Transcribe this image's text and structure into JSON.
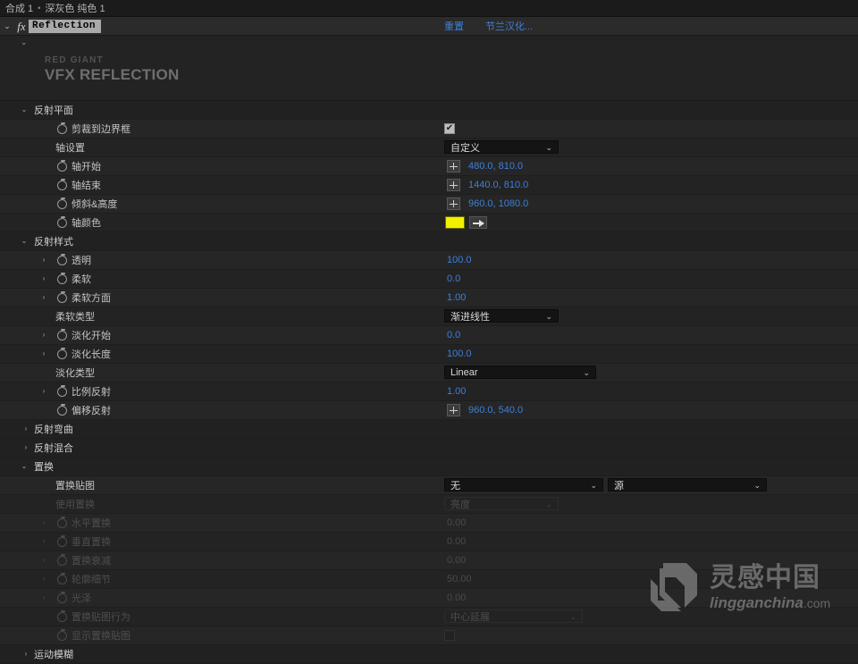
{
  "comp_bar": {
    "comp_name": "合成 1",
    "separator": "•",
    "layer_name": "深灰色 纯色 1"
  },
  "effect_header": {
    "twirl": "⌄",
    "fx_icon": "fx",
    "effect_name": "Reflection",
    "reset_label": "重置",
    "translate_label": "节兰汉化..."
  },
  "logo": {
    "twirl": "⌄",
    "brand_small": "RED GIANT",
    "brand_large": "VFX REFLECTION"
  },
  "groups": {
    "reflection_plane": "反射平面",
    "reflection_style": "反射样式",
    "reflection_bend": "反射弯曲",
    "reflection_blend": "反射混合",
    "displacement": "置换",
    "motion_blur": "运动模糊"
  },
  "params": {
    "clip_to_bounds": {
      "label": "剪裁到边界框",
      "checked": true,
      "check_glyph": "✔"
    },
    "axis_settings": {
      "label": "轴设置",
      "value": "自定义"
    },
    "axis_start": {
      "label": "轴开始",
      "value": "480.0, 810.0"
    },
    "axis_end": {
      "label": "轴结束",
      "value": "1440.0, 810.0"
    },
    "tilt_height": {
      "label": "倾斜&高度",
      "value": "960.0, 1080.0"
    },
    "axis_color": {
      "label": "轴颜色",
      "color": "#f2f200"
    },
    "transparency": {
      "label": "透明",
      "value": "100.0"
    },
    "softness": {
      "label": "柔软",
      "value": "0.0"
    },
    "softness_aspect": {
      "label": "柔软方面",
      "value": "1.00"
    },
    "softness_type": {
      "label": "柔软类型",
      "value": "渐进线性"
    },
    "fade_start": {
      "label": "淡化开始",
      "value": "0.0"
    },
    "fade_length": {
      "label": "淡化长度",
      "value": "100.0"
    },
    "fade_type": {
      "label": "淡化类型",
      "value": "Linear"
    },
    "scale_reflection": {
      "label": "比例反射",
      "value": "1.00"
    },
    "offset_reflection": {
      "label": "偏移反射",
      "value": "960.0, 540.0"
    },
    "displacement_map": {
      "label": "置换贴图",
      "value": "无",
      "channel": "源"
    },
    "use_displacement": {
      "label": "使用置换",
      "value": "亮度"
    },
    "horizontal_displacement": {
      "label": "水平置换",
      "value": "0.00"
    },
    "vertical_displacement": {
      "label": "垂直置换",
      "value": "0.00"
    },
    "displacement_falloff": {
      "label": "置换衰减",
      "value": "0.00"
    },
    "contour_detail": {
      "label": "轮廓细节",
      "value": "50.00"
    },
    "gloss": {
      "label": "光泽",
      "value": "0.00"
    },
    "map_behavior": {
      "label": "置换贴图行为",
      "value": "中心延展"
    },
    "show_map": {
      "label": "显示置换贴图",
      "checked": false
    }
  },
  "icons": {
    "twirl_open": "⌄",
    "twirl_closed": "›",
    "caret_down": "⌄"
  },
  "watermark": {
    "cn": "灵感中国",
    "en": "lingganchina",
    "domain": ".com"
  }
}
